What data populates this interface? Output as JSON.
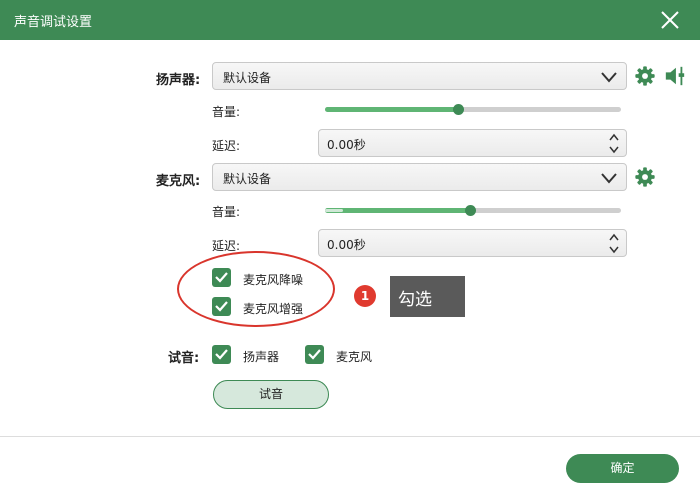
{
  "window": {
    "title": "声音调试设置"
  },
  "speaker": {
    "label": "扬声器:",
    "device": "默认设备",
    "volume_label": "音量:",
    "volume_level": 0.45,
    "delay_label": "延迟:",
    "delay_value": "0.00秒"
  },
  "microphone": {
    "label": "麦克风:",
    "device": "默认设备",
    "volume_label": "音量:",
    "volume_level": 0.49,
    "delay_label": "延迟:",
    "delay_value": "0.00秒",
    "noise_reduction_label": "麦克风降噪",
    "noise_reduction_checked": true,
    "enhance_label": "麦克风增强",
    "enhance_checked": true
  },
  "annotation": {
    "badge_number": "1",
    "callout_text": "勾选"
  },
  "test": {
    "label": "试音:",
    "speaker_label": "扬声器",
    "speaker_checked": true,
    "mic_label": "麦克风",
    "mic_checked": true,
    "button_label": "试音"
  },
  "footer": {
    "ok_label": "确定"
  },
  "colors": {
    "accent": "#3e8a55",
    "slider_fill": "#5fb574",
    "annotation_red": "#d9352c"
  }
}
